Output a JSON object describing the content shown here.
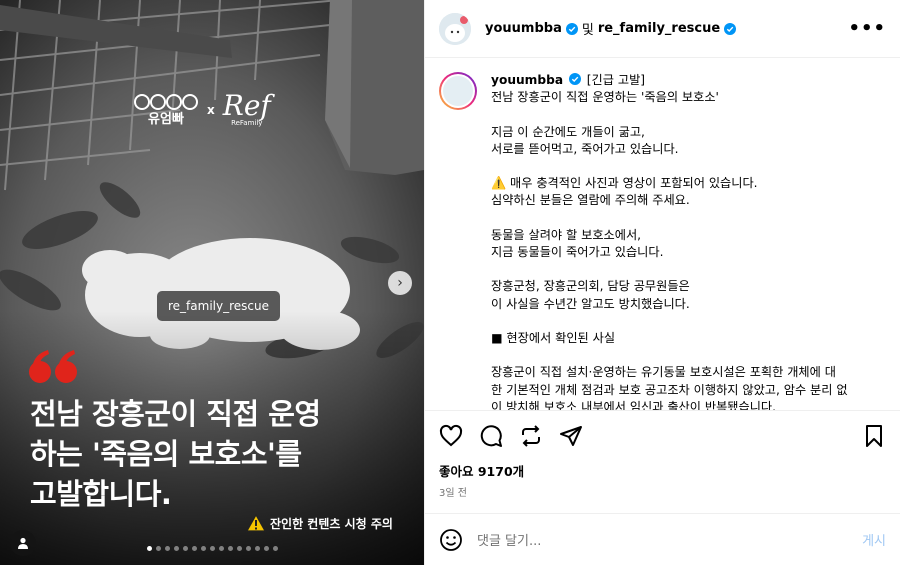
{
  "media": {
    "brand_left": "유엄빠",
    "brand_x": "x",
    "brand_right": "Ref",
    "brand_right_sub": "ReFamily",
    "tag": "re_family_rescue",
    "headline_lines": [
      "전남 장흥군이 직접 운영",
      "하는 '죽음의 보호소'를",
      "고발합니다."
    ],
    "warning": "잔인한 컨텐츠 시청 주의",
    "carousel_count": 15,
    "carousel_active": 0
  },
  "header": {
    "user1": "youumbba",
    "conj": "및",
    "user2": "re_family_rescue",
    "more": "•••"
  },
  "caption": {
    "user": "youumbba",
    "lines": [
      "[긴급 고발]",
      "전남 장흥군이 직접 운영하는 '죽음의 보호소'",
      "",
      "지금 이 순간에도 개들이 굶고,",
      "서로를 뜯어먹고, 죽어가고 있습니다.",
      "",
      "⚠️ 매우 충격적인 사진과 영상이 포함되어 있습니다.",
      "심약하신 분들은 열람에 주의해 주세요.",
      "",
      "동물을 살려야 할 보호소에서,",
      "지금 동물들이 죽어가고 있습니다.",
      "",
      "장흥군청, 장흥군의회, 담당 공무원들은",
      "이 사실을 수년간 알고도 방치했습니다.",
      "",
      "■ 현장에서 확인된 사실",
      "",
      "장흥군이 직접 설치·운영하는 유기동물 보호시설은 포획한 개체에 대",
      "한 기본적인 개체 점검과 보호 공고조차 이행하지 않았고, 암수 분리 없",
      "이 방치해 보호소 내부에서 임신과 출산이 반복됐습니다."
    ]
  },
  "stats": {
    "likes": "좋아요 9170개",
    "time": "3일 전"
  },
  "comment": {
    "placeholder": "댓글 달기...",
    "post_label": "게시"
  },
  "colors": {
    "verified": "#0095f6",
    "quote_red": "#e0241b",
    "post_button": "#9fc7f3"
  }
}
